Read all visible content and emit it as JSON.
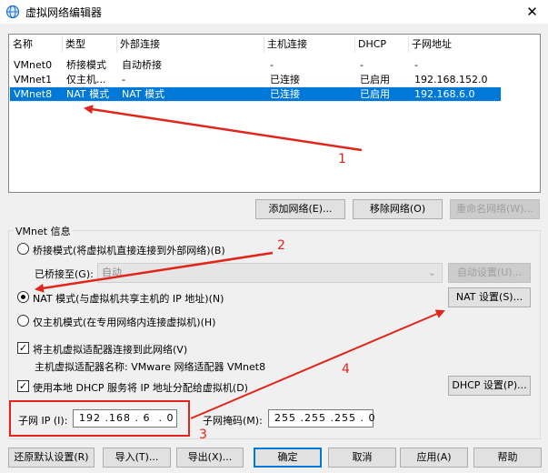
{
  "window": {
    "title": "虚拟网络编辑器",
    "close_glyph": "✕"
  },
  "network_list": {
    "columns": [
      "名称",
      "类型",
      "外部连接",
      "主机连接",
      "DHCP",
      "子网地址"
    ],
    "rows": [
      [
        "VMnet0",
        "桥接模式",
        "自动桥接",
        "-",
        "-",
        "-"
      ],
      [
        "VMnet1",
        "仅主机...",
        "-",
        "已连接",
        "已启用",
        "192.168.152.0"
      ],
      [
        "VMnet8",
        "NAT 模式",
        "NAT 模式",
        "已连接",
        "已启用",
        "192.168.6.0"
      ]
    ],
    "selected_index": 2
  },
  "list_buttons": {
    "add": "添加网络(E)...",
    "remove": "移除网络(O)",
    "rename": "重命名网络(W)..."
  },
  "vmnet_info": {
    "title": "VMnet 信息",
    "bridge_label": "桥接模式(将虚拟机直接连接到外部网络)(B)",
    "bridged_to_label": "已桥接至(G):",
    "bridged_to_value": "自动",
    "auto_settings": "自动设置(U)...",
    "nat_label": "NAT 模式(与虚拟机共享主机的 IP 地址)(N)",
    "nat_settings": "NAT 设置(S)...",
    "host_only_label": "仅主机模式(在专用网络内连接虚拟机)(H)",
    "connect_adapter_label": "将主机虚拟适配器连接到此网络(V)",
    "adapter_name_label": "主机虚拟适配器名称: VMware 网络适配器 VMnet8",
    "dhcp_label": "使用本地 DHCP 服务将 IP 地址分配给虚拟机(D)",
    "dhcp_settings": "DHCP 设置(P)...",
    "subnet_ip_label": "子网 IP (I):",
    "subnet_ip_value": "192 .168 . 6  . 0",
    "subnet_mask_label": "子网掩码(M):",
    "subnet_mask_value": "255 .255 .255 . 0",
    "selected_mode": "nat",
    "connect_adapter_checked": true,
    "dhcp_checked": true
  },
  "bottom_buttons": {
    "restore": "还原默认设置(R)",
    "import": "导入(T)...",
    "export": "导出(X)...",
    "ok": "确定",
    "cancel": "取消",
    "apply": "应用(A)",
    "help": "帮助"
  },
  "annotations": {
    "n1": "1",
    "n2": "2",
    "n3": "3",
    "n4": "4",
    "color": "#e1251b"
  },
  "colors": {
    "selection": "#0078d7",
    "window_bg": "#f0f0f0"
  }
}
